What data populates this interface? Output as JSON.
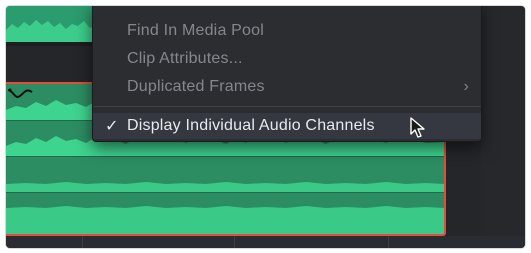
{
  "context_menu": {
    "items": [
      {
        "label": "Find In Media Pool",
        "enabled": false
      },
      {
        "label": "Clip Attributes...",
        "enabled": false
      },
      {
        "label": "Duplicated Frames",
        "enabled": false,
        "submenu_arrow": "›"
      },
      {
        "label": "Display Individual Audio Channels",
        "enabled": true,
        "checked": true,
        "check_glyph": "✓"
      }
    ]
  },
  "colors": {
    "clip_green": "#2b9c6d",
    "waveform_green": "#3ed38f",
    "selection_border": "#e34d3d",
    "menu_bg": "#2b2d31",
    "menu_text_disabled": "#84878d",
    "menu_text_active": "#e8e9eb"
  },
  "icons": {
    "clip_curve": "volume-curve-icon",
    "cursor": "mouse-pointer-icon"
  }
}
